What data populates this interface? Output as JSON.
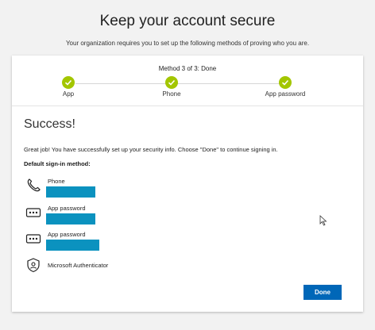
{
  "header": {
    "title": "Keep your account secure",
    "subtitle": "Your organization requires you to set up the following methods of proving who you are."
  },
  "progress": {
    "step_text": "Method 3 of 3: Done",
    "steps": [
      {
        "label": "App",
        "status": "complete"
      },
      {
        "label": "Phone",
        "status": "complete"
      },
      {
        "label": "App password",
        "status": "complete"
      }
    ]
  },
  "main": {
    "heading": "Success!",
    "message": "Great job! You have successfully set up your security info. Choose \"Done\" to continue signing in.",
    "default_heading": "Default sign-in method:",
    "methods": [
      {
        "name": "Phone",
        "icon": "phone-icon"
      },
      {
        "name": "App password",
        "icon": "app-password-icon"
      },
      {
        "name": "App password",
        "icon": "app-password-icon"
      },
      {
        "name": "Microsoft Authenticator",
        "icon": "authenticator-icon"
      }
    ]
  },
  "actions": {
    "done_label": "Done"
  },
  "colors": {
    "check": "#a3c600",
    "button": "#0067b8",
    "redaction": "#0b92bf"
  }
}
